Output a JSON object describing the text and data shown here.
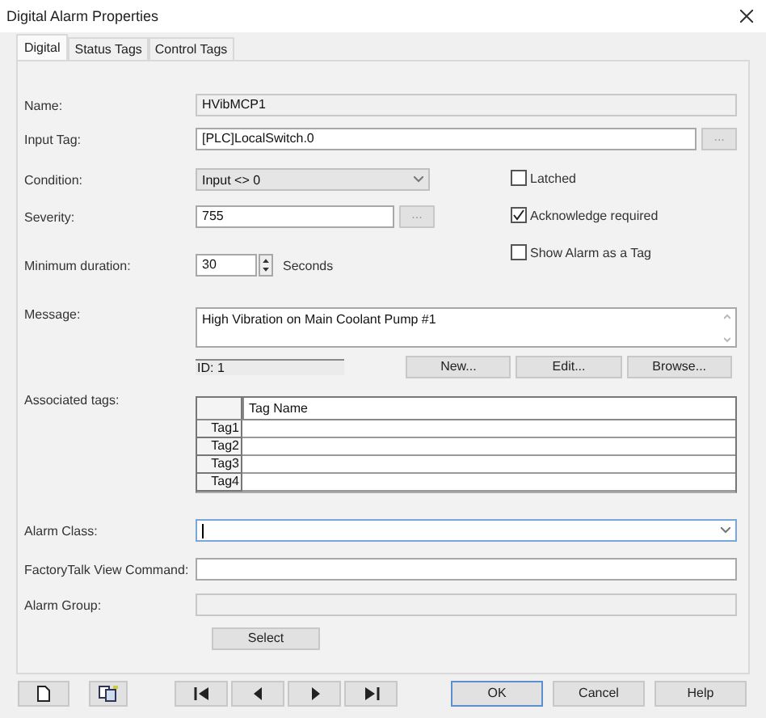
{
  "window": {
    "title": "Digital Alarm Properties"
  },
  "tabs": [
    {
      "label": "Digital",
      "selected": true
    },
    {
      "label": "Status Tags",
      "selected": false
    },
    {
      "label": "Control Tags",
      "selected": false
    }
  ],
  "name": {
    "label": "Name:",
    "value": "HVibMCP1",
    "disabled": true
  },
  "input_tag": {
    "label": "Input Tag:",
    "value": "[PLC]LocalSwitch.0",
    "disabled": false,
    "browse": "..."
  },
  "condition": {
    "label": "Condition:",
    "value": "Input <> 0"
  },
  "severity": {
    "label": "Severity:",
    "value": "755",
    "disabled": false,
    "browse": "..."
  },
  "minimum_duration": {
    "label": "Minimum duration:",
    "value": "30",
    "unit": "Seconds"
  },
  "options": [
    {
      "label": "Latched",
      "checked": false
    },
    {
      "label": "Acknowledge required",
      "checked": true
    },
    {
      "label": "Show Alarm as a Tag",
      "checked": false
    }
  ],
  "message": {
    "label": "Message:",
    "value": "High Vibration on Main Coolant Pump #1",
    "id": "ID: 1",
    "buttons": [
      "New...",
      "Edit...",
      "Browse..."
    ]
  },
  "associated_tags": {
    "label": "Associated tags:",
    "column": "Tag Name",
    "rows": [
      "Tag1",
      "Tag2",
      "Tag3",
      "Tag4"
    ]
  },
  "alarm_class": {
    "label": "Alarm Class:",
    "focused": true
  },
  "factorytalk_command": {
    "label": "FactoryTalk View Command:",
    "disabled": false
  },
  "alarm_group": {
    "label": "Alarm Group:",
    "disabled": true,
    "button": "Select"
  },
  "dialog_buttons": [
    {
      "label": "OK",
      "default": true
    },
    {
      "label": "Cancel",
      "default": false
    },
    {
      "label": "Help",
      "default": false
    }
  ]
}
